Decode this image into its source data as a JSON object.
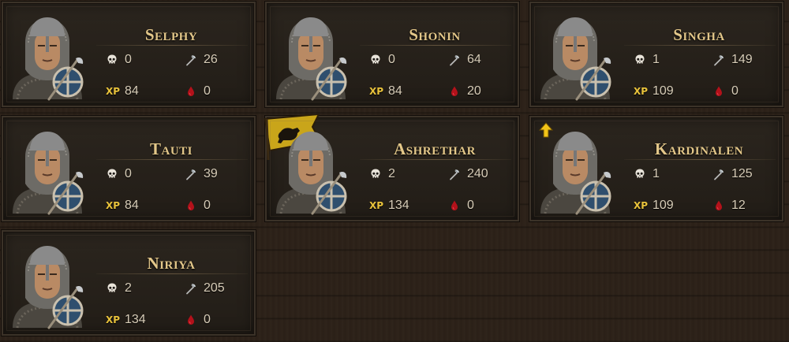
{
  "colors": {
    "name": "#e3c789",
    "stat": "#d8cdb8",
    "xp": "#e8c23b",
    "blood": "#b3111a",
    "panel": "#241e18"
  },
  "icons": {
    "kills": "skull-icon",
    "damage": "axe-icon",
    "xp": "xp-icon",
    "wounds": "blood-drop-icon",
    "levelup": "level-up-arrow-icon",
    "banner": "bear-banner-icon"
  },
  "xp_label": "XP",
  "units": [
    {
      "name": "Selphy",
      "kills": "0",
      "damage": "26",
      "xp": "84",
      "wounds": "0"
    },
    {
      "name": "Shonin",
      "kills": "0",
      "damage": "64",
      "xp": "84",
      "wounds": "20"
    },
    {
      "name": "Singha",
      "kills": "1",
      "damage": "149",
      "xp": "109",
      "wounds": "0"
    },
    {
      "name": "Tauti",
      "kills": "0",
      "damage": "39",
      "xp": "84",
      "wounds": "0"
    },
    {
      "name": "Ashrethar",
      "kills": "2",
      "damage": "240",
      "xp": "134",
      "wounds": "0",
      "has_banner": true
    },
    {
      "name": "Kardinalen",
      "kills": "1",
      "damage": "125",
      "xp": "109",
      "wounds": "12",
      "level_up": true
    },
    {
      "name": "Niriya",
      "kills": "2",
      "damage": "205",
      "xp": "134",
      "wounds": "0"
    }
  ]
}
